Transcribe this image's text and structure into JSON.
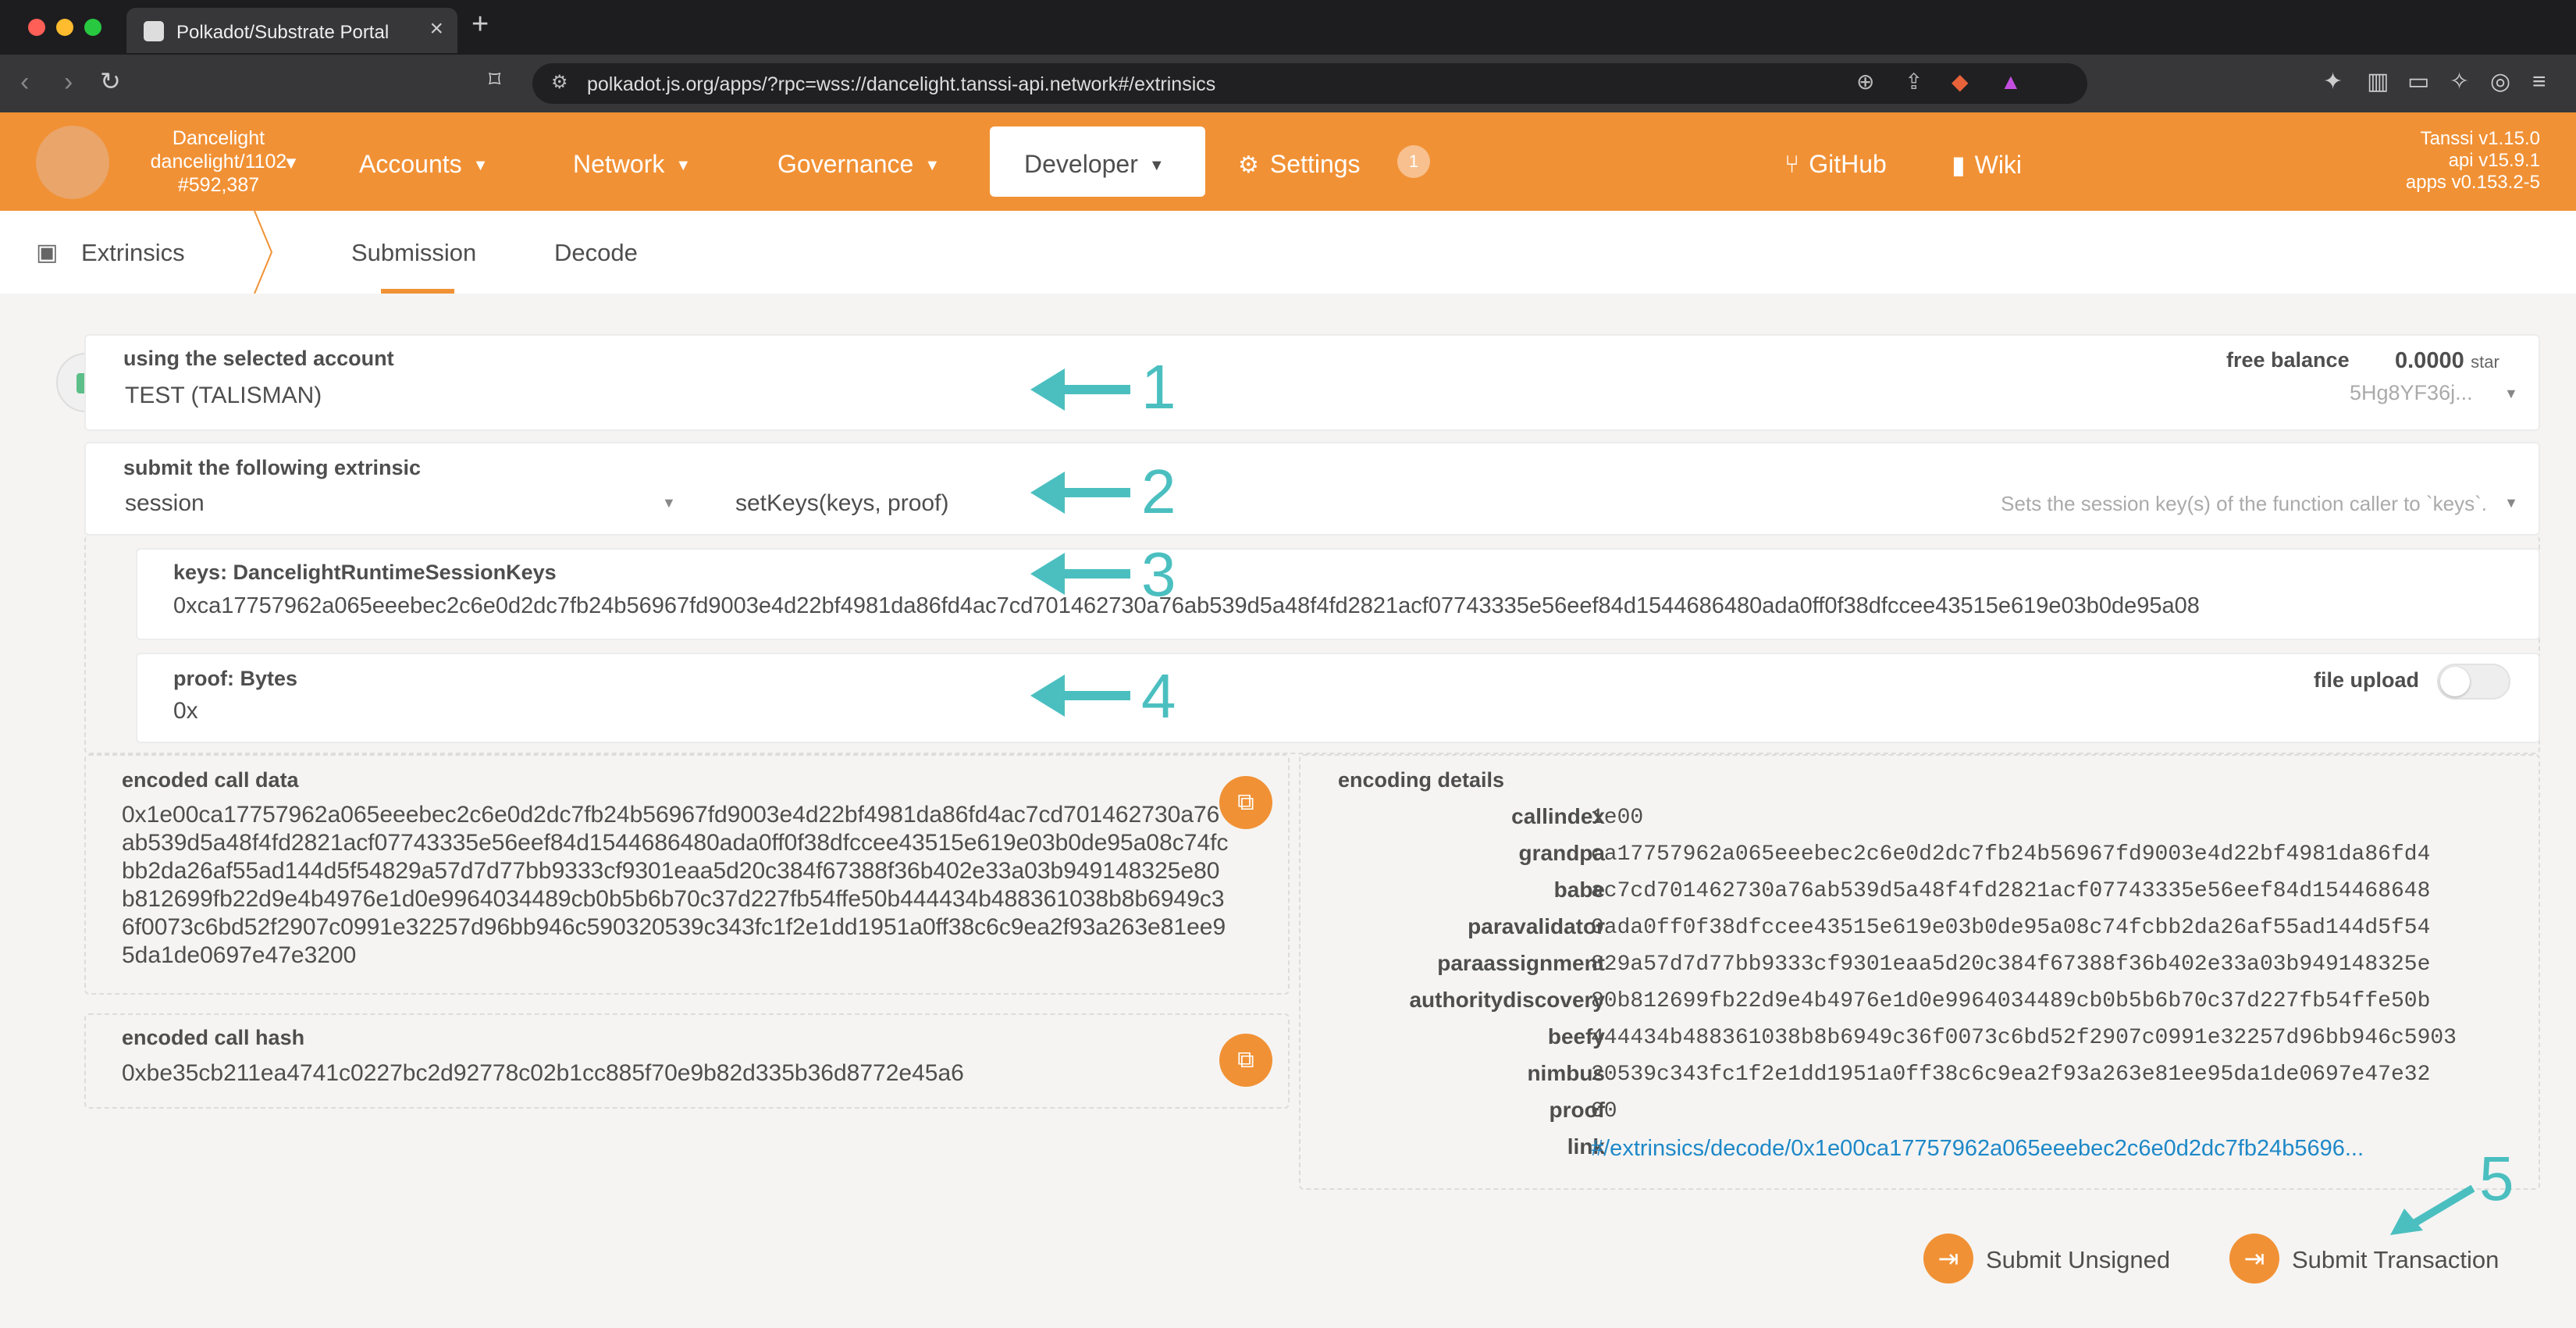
{
  "browser": {
    "tab_title": "Polkadot/Substrate Portal",
    "url": "polkadot.js.org/apps/?rpc=wss://dancelight.tanssi-api.network#/extrinsics"
  },
  "header": {
    "chain_name": "Dancelight",
    "chain_spec": "dancelight/1102",
    "block": "#592,387",
    "menu": {
      "accounts": "Accounts",
      "network": "Network",
      "governance": "Governance",
      "developer": "Developer",
      "settings": "Settings",
      "settings_badge": "1",
      "github": "GitHub",
      "wiki": "Wiki"
    },
    "versions": [
      "Tanssi v1.15.0",
      "api v15.9.1",
      "apps v0.153.2-5"
    ]
  },
  "subnav": {
    "section": "Extrinsics",
    "tabs": [
      "Submission",
      "Decode"
    ]
  },
  "account": {
    "label": "using the selected account",
    "name": "TEST (TALISMAN)",
    "balance_label": "free balance",
    "balance_value": "0.0000",
    "balance_unit": "star",
    "address": "5Hg8YF36j..."
  },
  "extrinsic": {
    "label": "submit the following extrinsic",
    "pallet": "session",
    "method": "setKeys(keys, proof)",
    "description": "Sets the session key(s) of the function caller to `keys`."
  },
  "params": {
    "keys_label": "keys: DancelightRuntimeSessionKeys",
    "keys_value": "0xca17757962a065eeebec2c6e0d2dc7fb24b56967fd9003e4d22bf4981da86fd4ac7cd701462730a76ab539d5a48f4fd2821acf07743335e56eef84d1544686480ada0ff0f38dfccee43515e619e03b0de95a08",
    "proof_label": "proof: Bytes",
    "proof_value": "0x",
    "file_upload": "file upload"
  },
  "encoded": {
    "call_data_label": "encoded call data",
    "call_data": "0x1e00ca17757962a065eeebec2c6e0d2dc7fb24b56967fd9003e4d22bf4981da86fd4ac7cd701462730a76ab539d5a48f4fd2821acf07743335e56eef84d1544686480ada0ff0f38dfccee43515e619e03b0de95a08c74fcbb2da26af55ad144d5f54829a57d7d77bb9333cf9301eaa5d20c384f67388f36b402e33a03b949148325e80b812699fb22d9e4b4976e1d0e9964034489cb0b5b6b70c37d227fb54ffe50b444434b488361038b8b6949c36f0073c6bd52f2907c0991e32257d96bb946c590320539c343fc1f2e1dd1951a0ff38c6c9ea2f93a263e81ee95da1de0697e47e3200",
    "call_hash_label": "encoded call hash",
    "call_hash": "0xbe35cb211ea4741c0227bc2d92778c02b1cc885f70e9b82d335b36d8772e45a6"
  },
  "encoding_details": {
    "label": "encoding details",
    "rows": [
      {
        "key": "callindex",
        "value": "1e00"
      },
      {
        "key": "grandpa",
        "value": "ca17757962a065eeebec2c6e0d2dc7fb24b56967fd9003e4d22bf4981da86fd4"
      },
      {
        "key": "babe",
        "value": "ac7cd701462730a76ab539d5a48f4fd2821acf07743335e56eef84d154468648"
      },
      {
        "key": "paravalidator",
        "value": "0ada0ff0f38dfccee43515e619e03b0de95a08c74fcbb2da26af55ad144d5f54"
      },
      {
        "key": "paraassignment",
        "value": "829a57d7d77bb9333cf9301eaa5d20c384f67388f36b402e33a03b949148325e"
      },
      {
        "key": "authoritydiscovery",
        "value": "80b812699fb22d9e4b4976e1d0e9964034489cb0b5b6b70c37d227fb54ffe50b"
      },
      {
        "key": "beefy",
        "value": "444434b488361038b8b6949c36f0073c6bd52f2907c0991e32257d96bb946c5903"
      },
      {
        "key": "nimbus",
        "value": "20539c343fc1f2e1dd1951a0ff38c6c9ea2f93a263e81ee95da1de0697e47e32"
      },
      {
        "key": "proof",
        "value": "00"
      },
      {
        "key": "link",
        "value": "#/extrinsics/decode/0x1e00ca17757962a065eeebec2c6e0d2dc7fb24b5696..."
      }
    ]
  },
  "actions": {
    "submit_unsigned": "Submit Unsigned",
    "submit_transaction": "Submit Transaction"
  },
  "annotations": [
    "1",
    "2",
    "3",
    "4",
    "5"
  ],
  "colors": {
    "accent": "#f19135",
    "annotation": "#4bbfc0",
    "link": "#1e88c7"
  }
}
